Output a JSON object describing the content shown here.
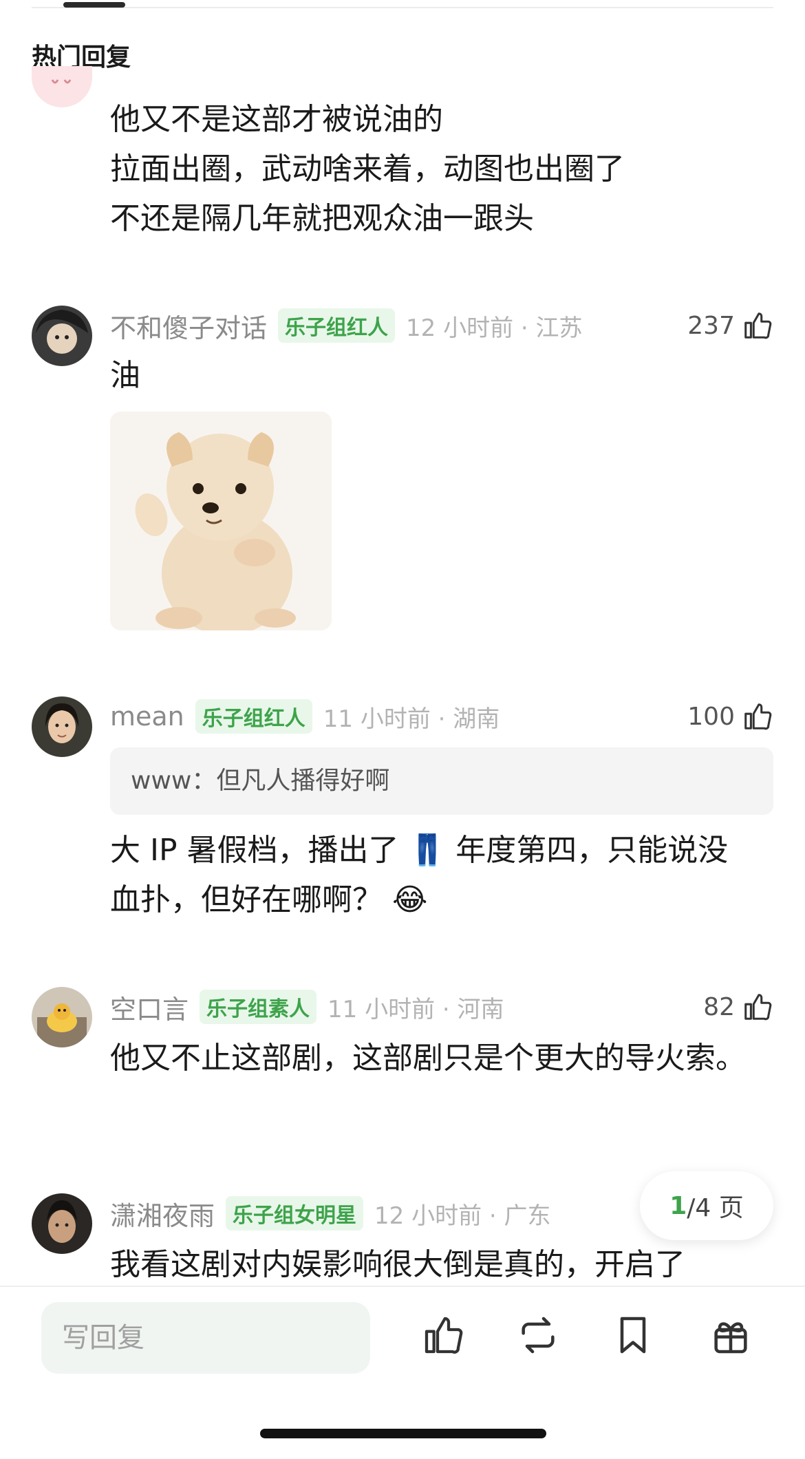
{
  "section_title": "热门回复",
  "comments": [
    {
      "lines": [
        "他又不是这部才被说油的",
        "拉面出圈，武动啥来着，动图也出圈了",
        "不还是隔几年就把观众油一跟头"
      ]
    },
    {
      "username": "不和傻子对话",
      "badge": "乐子组红人",
      "meta": "12 小时前 · 江苏",
      "likes": "237",
      "text": "油"
    },
    {
      "username": "mean",
      "badge": "乐子组红人",
      "meta": "11 小时前 · 湖南",
      "likes": "100",
      "quote": "www：但凡人播得好啊",
      "text_a": "大 IP 暑假档，播出了",
      "jeans_emoji": "👖",
      "text_b": "年度第四，只能说没",
      "text_c": "血扑，但好在哪啊？",
      "laugh_emoji": "😂"
    },
    {
      "username": "空口言",
      "badge": "乐子组素人",
      "meta": "11 小时前 · 河南",
      "likes": "82",
      "text": "他又不止这部剧，这部剧只是个更大的导火索。"
    },
    {
      "username": "潇湘夜雨",
      "badge": "乐子组女明星",
      "meta": "12 小时前 · 广东",
      "text": "我看这剧对内娱影响很大倒是真的，开启了"
    }
  ],
  "pager": {
    "current": "1",
    "total": "/4 页"
  },
  "bottom_bar": {
    "reply_placeholder": "写回复"
  },
  "colors": {
    "accent_green": "#3ea34b",
    "badge_bg": "#e8f7ea",
    "meta_gray": "#b3b3b3"
  }
}
